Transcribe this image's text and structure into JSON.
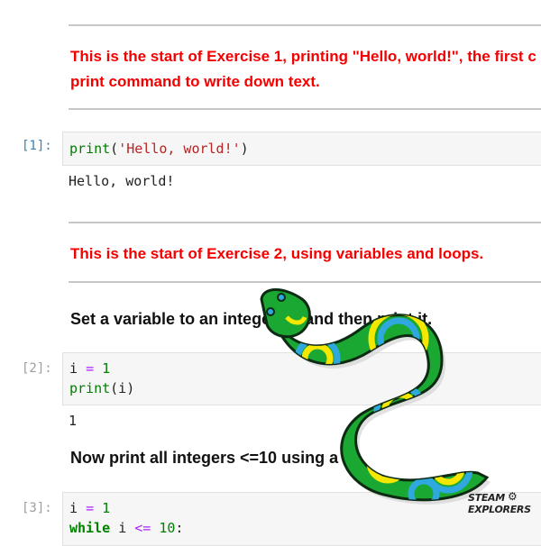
{
  "markdown": {
    "ex1_line1": "This is the start of Exercise 1, printing \"Hello, world!\", the first c",
    "ex1_line2": "print command to write down text.",
    "ex2": "This is the start of Exercise 2, using variables and loops.",
    "set_var": "Set a variable to an intege     ber and then print it.",
    "print_all": "Now print all integers <=10 using a lo"
  },
  "cells": [
    {
      "prompt": "[1]:",
      "code": {
        "fn": "print",
        "open": "(",
        "str": "'Hello, world!'",
        "close": ")"
      },
      "output": "Hello, world!"
    },
    {
      "prompt": "[2]:",
      "code": {
        "l1_var": "i",
        "l1_op": "=",
        "l1_num": "1",
        "l2_fn": "print",
        "l2_args": "(i)"
      },
      "output": "1"
    },
    {
      "prompt": "[3]:",
      "code": {
        "l1_var": "i",
        "l1_op": "=",
        "l1_num": "1",
        "l2_kw": "while",
        "l2_var": "i",
        "l2_op": "<=",
        "l2_num": "10",
        "l2_end": ":"
      }
    }
  ],
  "logo": {
    "line1": "STEAM",
    "line2": "EXPLORERS",
    "icon": "gear-icon"
  },
  "decoration": {
    "icon": "snake-icon",
    "body_color": "#1aa832",
    "ring_yellow": "#f5e700",
    "ring_blue": "#2fa8e0"
  }
}
